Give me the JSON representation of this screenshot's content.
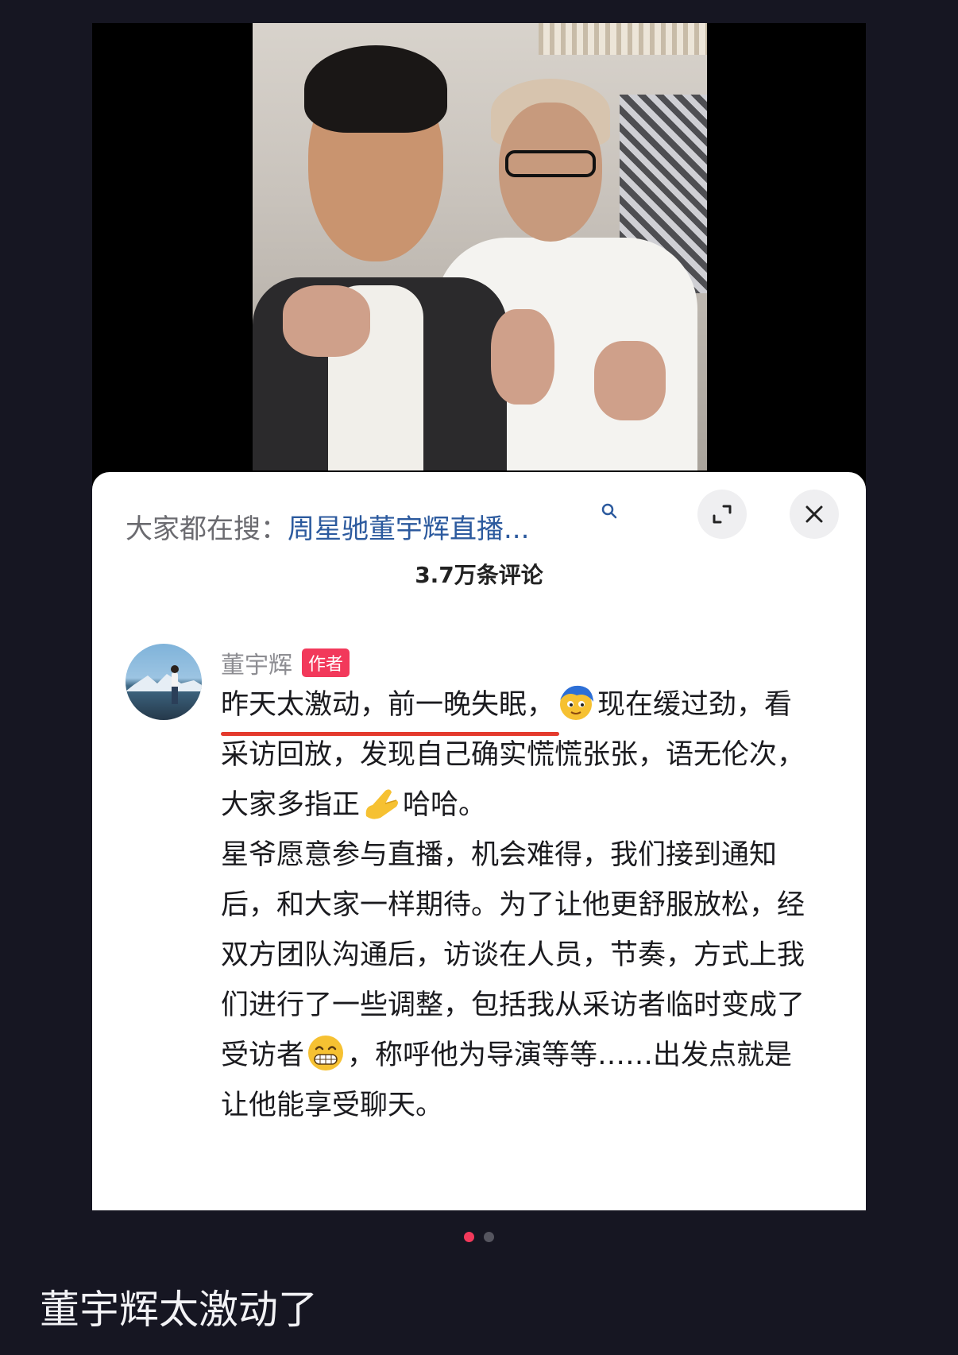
{
  "post": {
    "caption": "董宇辉太激动了"
  },
  "panel": {
    "search_prefix": "大家都在搜：",
    "search_term": "周星驰董宇辉直播...",
    "comment_count": "3.7万条评论"
  },
  "comment": {
    "author": "董宇辉",
    "badge": "作者",
    "seg1": "昨天太激动，前一晚失眠，",
    "seg2": "现在缓过劲，看采访回放，发现自己确实慌慌张张，语无伦次，大家多指正",
    "seg3": "哈哈。",
    "seg4": "星爷愿意参与直播，机会难得，我们接到通知后，和大家一样期待。为了让他更舒服放松，经双方团队沟通后，访谈在人员，节奏，方式上我们进行了一些调整，包括我从采访者临时变成了受访者",
    "seg5": "，称呼他为导演等等……出发点就是让他能享受聊天。"
  },
  "colors": {
    "accent": "#f2395b",
    "link": "#2c5a9e",
    "underline": "#e43a2d"
  },
  "icons": [
    "expand-icon",
    "close-icon",
    "search-icon",
    "blush-emoji",
    "bow-emoji",
    "grin-emoji"
  ]
}
